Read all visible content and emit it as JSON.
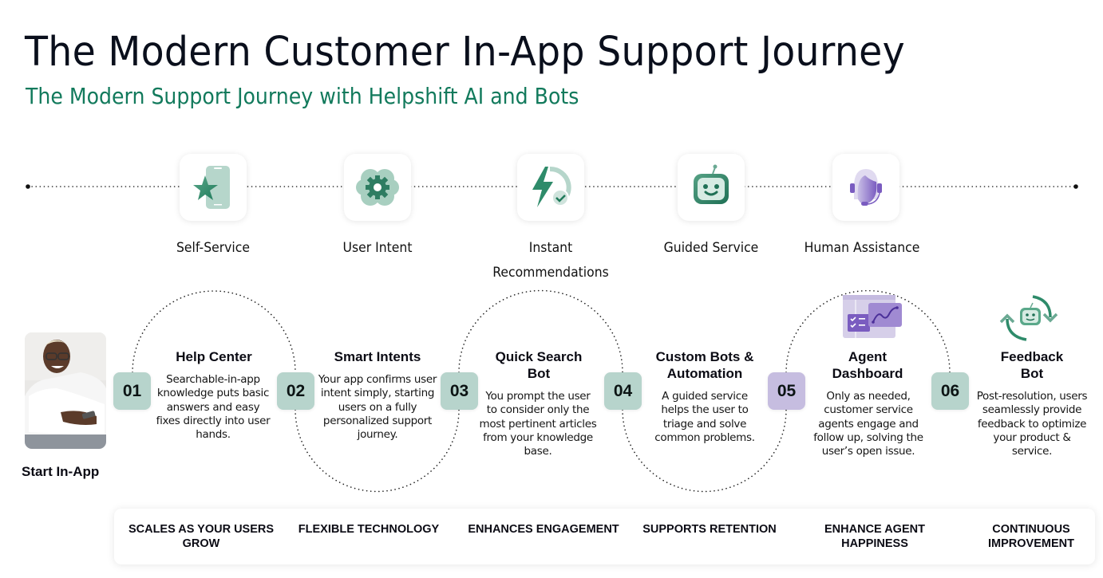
{
  "header": {
    "title": "The Modern Customer In-App Support Journey",
    "subtitle": "The Modern Support Journey with Helpshift AI and Bots"
  },
  "colors": {
    "subtitle_green": "#127a5c",
    "badge_green": "#b7d4cc",
    "badge_purple": "#c6bde0",
    "icon_green": "#2e8b6a",
    "icon_purple": "#7a5cc0"
  },
  "stages": [
    {
      "label": "Self-Service",
      "icon": "phone-star-icon"
    },
    {
      "label": "User Intent",
      "icon": "flower-gear-icon"
    },
    {
      "label": "Instant Recommendations",
      "icon": "lightning-clock-check-icon"
    },
    {
      "label": "Guided Service",
      "icon": "robot-face-icon"
    },
    {
      "label": "Human Assistance",
      "icon": "headset-agent-icon"
    }
  ],
  "start": {
    "label": "Start In-App",
    "image": "person-smiling-with-phone-photo"
  },
  "steps": [
    {
      "number": "01",
      "title": "Help Center",
      "description": "Searchable-in-app knowledge puts basic answers and easy fixes directly into user hands."
    },
    {
      "number": "02",
      "title": "Smart Intents",
      "description": "Your app confirms user intent simply, starting users on a fully personalized support journey."
    },
    {
      "number": "03",
      "title": "Quick Search Bot",
      "description": "You prompt the user to consider only the most pertinent articles from your knowledge base."
    },
    {
      "number": "04",
      "title": "Custom Bots & Automation",
      "description": "A guided service helps the user to triage and solve common problems."
    },
    {
      "number": "05",
      "title": "Agent Dashboard",
      "description": "Only as needed, customer service agents engage and follow up, solving the user’s open issue.",
      "icon": "dashboard-chart-icon"
    },
    {
      "number": "06",
      "title": "Feedback Bot",
      "description": "Post-resolution, users seamlessly provide feedback to optimize your product & service.",
      "icon": "robot-refresh-icon"
    }
  ],
  "benefits": [
    "SCALES AS YOUR USERS GROW",
    "FLEXIBLE TECHNOLOGY",
    "ENHANCES ENGAGEMENT",
    "SUPPORTS RETENTION",
    "ENHANCE AGENT HAPPINESS",
    "CONTINUOUS IMPROVEMENT"
  ]
}
